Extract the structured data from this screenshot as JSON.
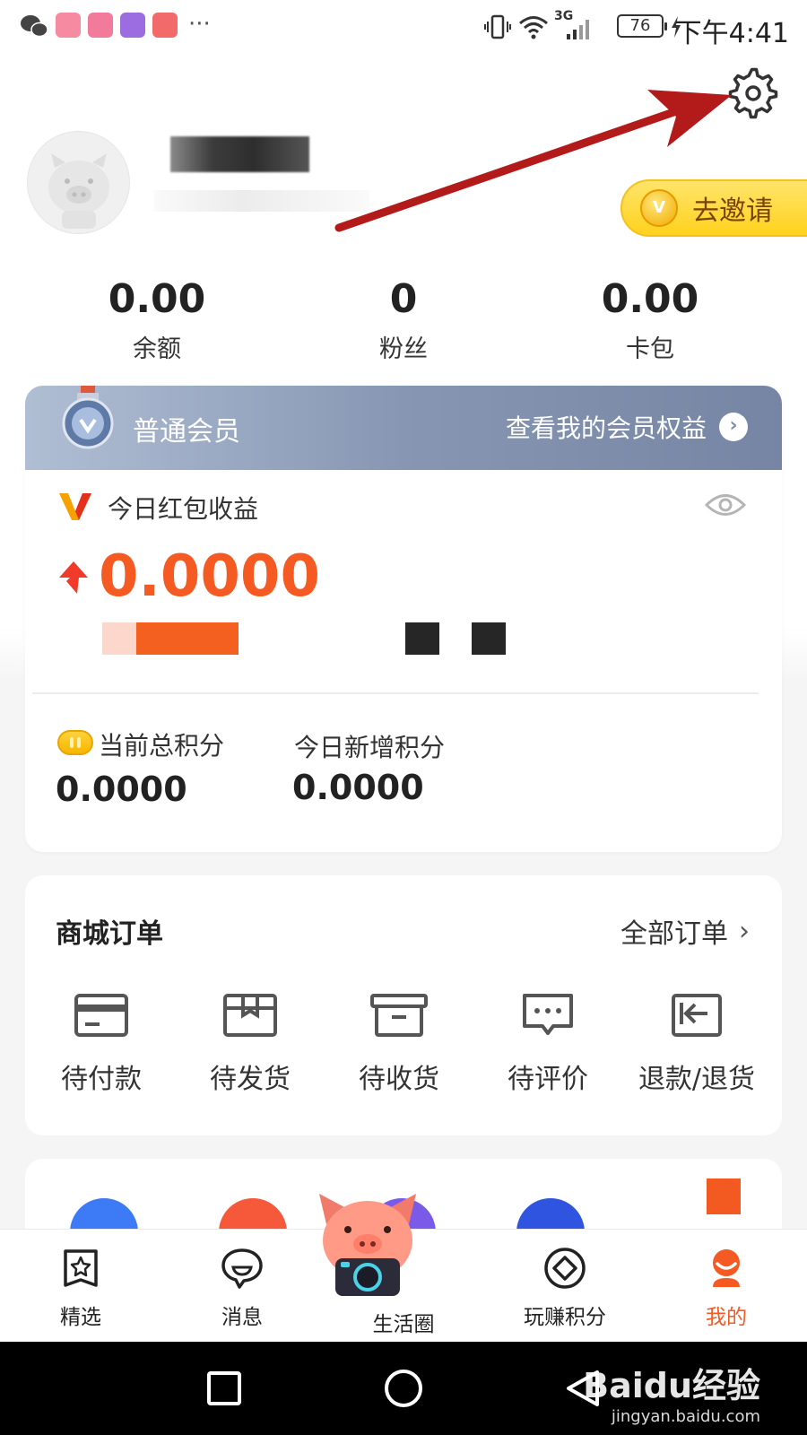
{
  "status_bar": {
    "time": "下午4:41",
    "battery": "76",
    "network": "3G",
    "more": "···"
  },
  "profile": {
    "invite_label": "去邀请",
    "invite_coin": "V"
  },
  "stats": [
    {
      "value": "0.00",
      "label": "余额"
    },
    {
      "value": "0",
      "label": "粉丝"
    },
    {
      "value": "0.00",
      "label": "卡包"
    }
  ],
  "membership": {
    "tier": "普通会员",
    "benefits_link": "查看我的会员权益",
    "benefits_chevron": "›"
  },
  "earnings": {
    "title": "今日红包收益",
    "value": "0.0000"
  },
  "points": {
    "total_label": "当前总积分",
    "total_value": "0.0000",
    "today_label": "今日新增积分",
    "today_value": "0.0000"
  },
  "orders": {
    "title": "商城订单",
    "all_link": "全部订单",
    "all_chevron": "›",
    "items": [
      {
        "label": "待付款",
        "icon": "card-icon"
      },
      {
        "label": "待发货",
        "icon": "box-icon"
      },
      {
        "label": "待收货",
        "icon": "archive-icon"
      },
      {
        "label": "待评价",
        "icon": "comment-icon"
      },
      {
        "label": "退款/退货",
        "icon": "return-icon"
      }
    ]
  },
  "bottom_nav": [
    {
      "label": "精选",
      "icon": "star-bag-icon"
    },
    {
      "label": "消息",
      "icon": "chat-bubble-icon"
    },
    {
      "label": "生活圈",
      "icon": "pig-mascot-icon"
    },
    {
      "label": "玩赚积分",
      "icon": "diamond-icon"
    },
    {
      "label": "我的",
      "icon": "profile-icon",
      "active": true
    }
  ],
  "watermark": {
    "brand": "Baidu经验",
    "url": "jingyan.baidu.com"
  },
  "colors": {
    "accent_orange": "#f55a22",
    "invite_yellow": "#ffd21e",
    "member_bar": "#8797b3",
    "annotation_arrow": "#b31b1b"
  }
}
